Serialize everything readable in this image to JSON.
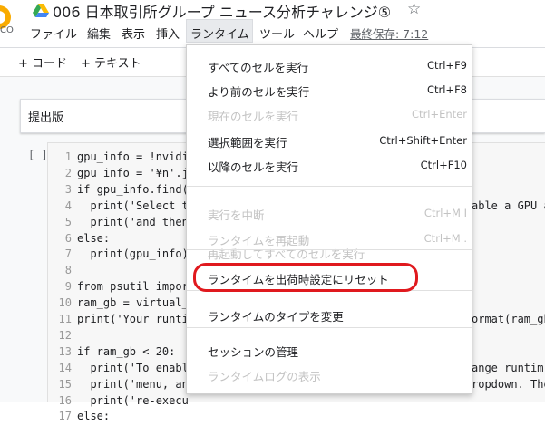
{
  "header": {
    "logo_text": "CO",
    "title": "006 日本取引所グループ ニュース分析チャレンジ⑤",
    "menu": [
      "ファイル",
      "編集",
      "表示",
      "挿入",
      "ランタイム",
      "ツール",
      "ヘルプ"
    ],
    "last_saved": "最終保存: 7:12"
  },
  "toolbar": {
    "add_code": "+ コード",
    "add_text": "+ テキスト"
  },
  "text_cell": {
    "label": "提出版"
  },
  "code_cell": {
    "run_indicator": "[ ]",
    "lines": [
      {
        "n": "1",
        "t": "gpu_info = !nvidi"
      },
      {
        "n": "2",
        "t": "gpu_info = '¥n'.j"
      },
      {
        "n": "3",
        "t": "if gpu_info.find("
      },
      {
        "n": "4",
        "t": "  print('Select t"
      },
      {
        "n": "5",
        "t": "  print('and then"
      },
      {
        "n": "6",
        "t": "else:"
      },
      {
        "n": "7",
        "t": "  print(gpu_info)"
      },
      {
        "n": "8",
        "t": ""
      },
      {
        "n": "9",
        "t": "from psutil impor"
      },
      {
        "n": "10",
        "t": "ram_gb = virtual_"
      },
      {
        "n": "11",
        "t": "print('Your runti"
      },
      {
        "n": "12",
        "t": ""
      },
      {
        "n": "13",
        "t": "if ram_gb < 20:"
      },
      {
        "n": "14",
        "t": "  print('To enabl"
      },
      {
        "n": "15",
        "t": "  print('menu, an"
      },
      {
        "n": "16",
        "t": "  print('re-execu"
      },
      {
        "n": "17",
        "t": "else:"
      }
    ],
    "right_fragments": [
      {
        "line": 4,
        "t": "able a GPU a"
      },
      {
        "line": 11,
        "t": "ormat(ram_gb"
      },
      {
        "line": 14,
        "t": "ange runtim"
      },
      {
        "line": 15,
        "t": "ropdown. The"
      }
    ]
  },
  "runtime_menu": {
    "items": [
      {
        "label": "すべてのセルを実行",
        "shortcut": "Ctrl+F9",
        "enabled": true
      },
      {
        "label": "より前のセルを実行",
        "shortcut": "Ctrl+F8",
        "enabled": true
      },
      {
        "label": "現在のセルを実行",
        "shortcut": "Ctrl+Enter",
        "enabled": false
      },
      {
        "label": "選択範囲を実行",
        "shortcut": "Ctrl+Shift+Enter",
        "enabled": true
      },
      {
        "label": "以降のセルを実行",
        "shortcut": "Ctrl+F10",
        "enabled": true
      },
      {
        "label": "実行を中断",
        "shortcut": "Ctrl+M I",
        "enabled": false
      },
      {
        "label": "ランタイムを再起動",
        "shortcut": "Ctrl+M .",
        "enabled": false
      },
      {
        "label": "再起動してすべてのセルを実行",
        "shortcut": "",
        "enabled": false
      },
      {
        "label": "ランタイムを出荷時設定にリセット",
        "shortcut": "",
        "enabled": true
      },
      {
        "label": "ランタイムのタイプを変更",
        "shortcut": "",
        "enabled": true
      },
      {
        "label": "セッションの管理",
        "shortcut": "",
        "enabled": true
      },
      {
        "label": "ランタイムログの表示",
        "shortcut": "",
        "enabled": false
      }
    ]
  },
  "colors": {
    "highlight": "#e0191e",
    "logo_orange": "#f9ab00"
  }
}
